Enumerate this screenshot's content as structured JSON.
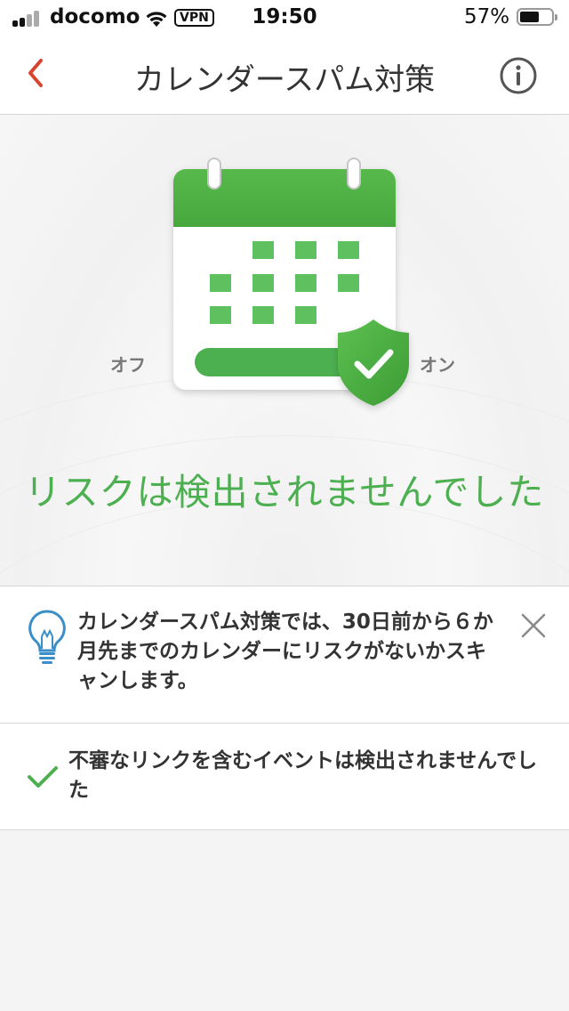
{
  "status_bar": {
    "carrier": "docomo",
    "vpn": "VPN",
    "time": "19:50",
    "battery_percent": "57%",
    "battery_level": 0.57
  },
  "nav": {
    "title": "カレンダースパム対策",
    "back_icon": "chevron-left-icon",
    "info_icon": "info-circle-icon"
  },
  "hero": {
    "label_off": "オフ",
    "label_on": "オン",
    "result": "リスクは検出されませんでした",
    "accent_color": "#4caf50"
  },
  "tip": {
    "icon": "lightbulb-icon",
    "text": "カレンダースパム対策では、30日前から６か月先までのカレンダーにリスクがないかスキャンします。",
    "close_icon": "close-icon"
  },
  "check_result": {
    "icon": "checkmark-icon",
    "text": "不審なリンクを含むイベントは検出されませんでした"
  }
}
